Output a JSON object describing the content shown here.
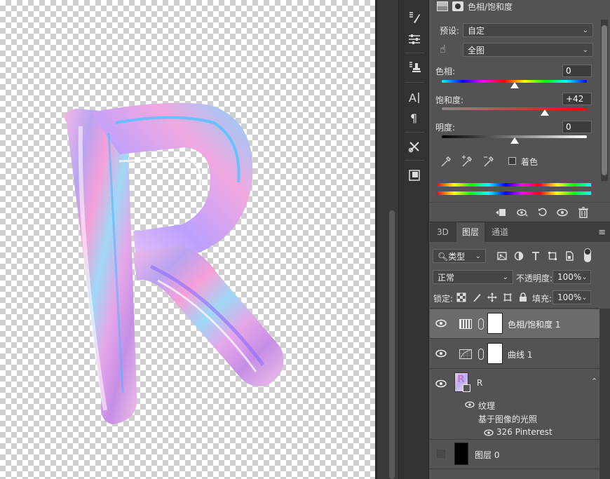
{
  "toolstrip": {
    "icons": [
      "brush-settings-icon",
      "adjust-sliders-icon",
      "clone-source-icon",
      "character-icon",
      "paragraph-icon",
      "tools-preset-icon",
      "artboard-icon"
    ]
  },
  "properties": {
    "title": "色相/饱和度",
    "preset_label": "预设:",
    "preset_value": "自定",
    "channel_value": "全图",
    "hue_label": "色相:",
    "hue_value": "0",
    "sat_label": "饱和度:",
    "sat_value": "+42",
    "light_label": "明度:",
    "light_value": "0",
    "hue_level": 0.5,
    "sat_level": 0.71,
    "light_level": 0.5,
    "colorize_label": "着色"
  },
  "layers_panel": {
    "tabs": [
      "3D",
      "图层",
      "通道"
    ],
    "active_tab": "图层",
    "filter_label": "类型",
    "blend_mode": "正常",
    "opacity_label": "不透明度:",
    "opacity_value": "100%",
    "lock_label": "锁定:",
    "fill_label": "填充:",
    "fill_value": "100%",
    "layers": [
      {
        "name": "色相/饱和度 1"
      },
      {
        "name": "曲线 1"
      },
      {
        "name": "R"
      },
      {
        "name": "图层 0"
      }
    ],
    "effects": {
      "texture": "纹理",
      "lighting": "基于图像的光照",
      "source": "326 Pinterest"
    }
  },
  "colors": {
    "panel_bg": "#535353",
    "dark_bg": "#323232",
    "selected_row": "#6b6b6b"
  }
}
